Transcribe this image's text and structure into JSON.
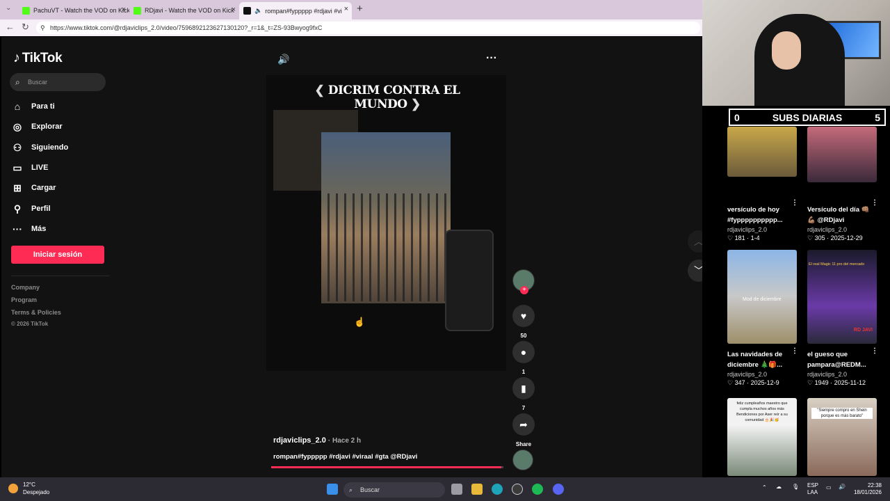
{
  "browser": {
    "tabs": [
      {
        "label": "PachuVT - Watch the VOD on Kick",
        "close": "×"
      },
      {
        "label": "RDjavi - Watch the VOD on Kick",
        "close": "×"
      },
      {
        "label": "rompan#fyppppp #rdjavi #vi",
        "close": "×"
      }
    ],
    "new_tab": "+",
    "url": "https://www.tiktok.com/@rdjaviclips_2.0/video/7596892123627130120?_r=1&_t=ZS-93Bwyog9fxC"
  },
  "tiktok": {
    "logo": "TikTok",
    "search_placeholder": "Buscar",
    "nav": [
      "Para ti",
      "Explorar",
      "Siguiendo",
      "LIVE",
      "Cargar",
      "Perfil",
      "Más"
    ],
    "nav_icons": [
      "home-icon",
      "compass-icon",
      "following-icon",
      "live-icon",
      "upload-icon",
      "profile-icon",
      "more-icon"
    ],
    "login_button": "Iniciar sesión",
    "footer": [
      "Company",
      "Program",
      "Terms & Policies",
      "© 2026 TikTok"
    ],
    "video": {
      "overlay_title": "DICRIM CONTRA EL MUNDO",
      "author": "rdjaviclips_2.0",
      "time": "Hace 2 h",
      "caption": "rompan#fyppppp #rdjavi #viraal #gta @RDjavi",
      "progress": 0.99
    },
    "actions": {
      "likes": "50",
      "comments": "1",
      "saves": "7",
      "share": "Share"
    }
  },
  "stream_overlay": {
    "subs_left": "0",
    "subs_title": "SUBS DIARIAS",
    "subs_right": "5"
  },
  "recommendations": [
    {
      "title": "versículo de hoy #fypppppppppp...",
      "user": "rdjaviclips_2.0",
      "meta": "♡ 181 · 1-4"
    },
    {
      "title": "Versículo del día 👊🏽💪🏽 @RDjavi",
      "user": "rdjaviclips_2.0",
      "meta": "♡ 305 · 2025-12-29"
    },
    {
      "title": "Las navidades de diciembre 🎄🎁...",
      "user": "rdjaviclips_2.0",
      "meta": "♡ 347 · 2025-12-9"
    },
    {
      "title": "el gueso que pampara@REDM...",
      "user": "rdjaviclips_2.0",
      "meta": "♡ 1949 · 2025-11-12"
    }
  ],
  "thumb_texts": {
    "card3": "Mod de diciembre",
    "card4_top": "El real Magic 11 pro del mercado",
    "card4_badge": "RD JAVI",
    "card5": "feliz cumpleaños maestro que cumpla muchos años más Bendiciones por Aser reír a su comunidad 🎂🎉🥳",
    "card6": "\"Siempre compro en Shein porque es más barato\""
  },
  "taskbar": {
    "temp": "12°C",
    "weather": "Despejado",
    "search": "Buscar",
    "lang1": "ESP",
    "lang2": "LAA",
    "time": "22:38",
    "date": "18/01/2026"
  },
  "colors": {
    "accent": "#fe2c55",
    "page_bg": "#121212"
  }
}
